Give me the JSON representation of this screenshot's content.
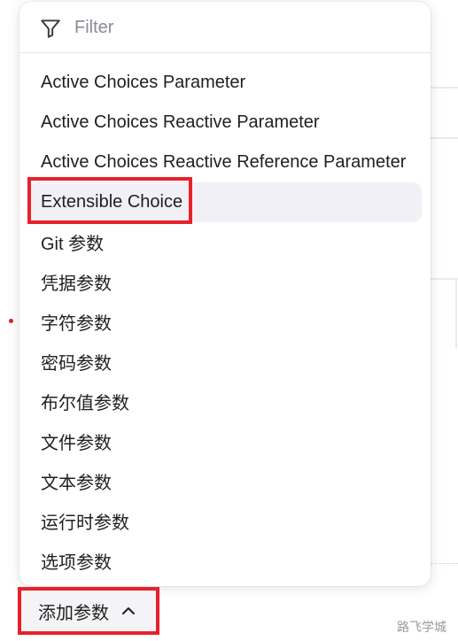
{
  "filter": {
    "placeholder": "Filter",
    "icon": "filter-icon"
  },
  "menu": {
    "items": [
      {
        "label": "Active Choices Parameter"
      },
      {
        "label": "Active Choices Reactive Parameter"
      },
      {
        "label": "Active Choices Reactive Reference Parameter"
      },
      {
        "label": "Extensible Choice"
      },
      {
        "label": "Git 参数"
      },
      {
        "label": "凭据参数"
      },
      {
        "label": "字符参数"
      },
      {
        "label": "密码参数"
      },
      {
        "label": "布尔值参数"
      },
      {
        "label": "文件参数"
      },
      {
        "label": "文本参数"
      },
      {
        "label": "运行时参数"
      },
      {
        "label": "选项参数"
      }
    ],
    "hovered_label": "Extensible Choice"
  },
  "add_param": {
    "label": "添加参数",
    "icon": "chevron-up-icon"
  },
  "watermark": "路飞学城",
  "colors": {
    "highlight": "#e8202a",
    "hover": "#f0f0f6"
  }
}
